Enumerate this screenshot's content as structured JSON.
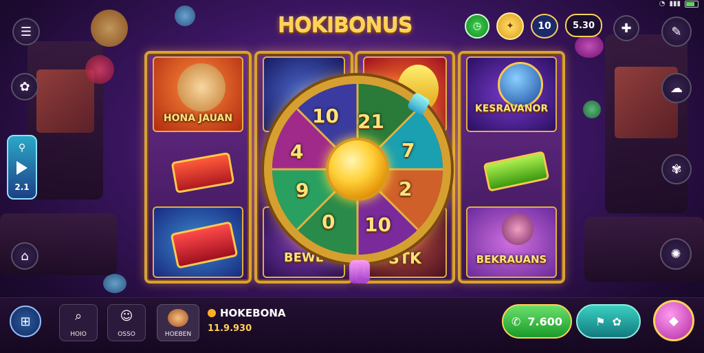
{
  "status": {
    "battery": "battery-icon",
    "wifi": "wifi-icon"
  },
  "logo": {
    "text": "HOKIBONUS"
  },
  "top_right": {
    "chip_timer_icon": "clock-icon",
    "chip_coin_icon": "coin-icon",
    "level": "10",
    "balance": "5.30"
  },
  "left_pill": {
    "value": "2.1"
  },
  "reels": {
    "col1": {
      "top_label": "HONA JAUAN"
    },
    "col2": {
      "bottom_label": "BEWE"
    },
    "col3": {
      "bottom_label": "STK"
    },
    "col4": {
      "top_label": "KESRAVANOR",
      "bottom_label": "BEKRAUANS"
    }
  },
  "wheel": {
    "segments": [
      "10",
      "21",
      "7",
      "2",
      "10",
      "0",
      "9",
      "4"
    ]
  },
  "bottom": {
    "slot1_label": "HOIO",
    "slot2_label": "OSSO",
    "slot3_label": "HOEBEN",
    "player_name": "HOKEBONA",
    "player_score": "11.9.930",
    "win_amount": "7.600"
  },
  "colors": {
    "accent_gold": "#ffd257",
    "green": "#3ccf4e",
    "teal": "#1fb8a8",
    "pink": "#e04fd0"
  }
}
